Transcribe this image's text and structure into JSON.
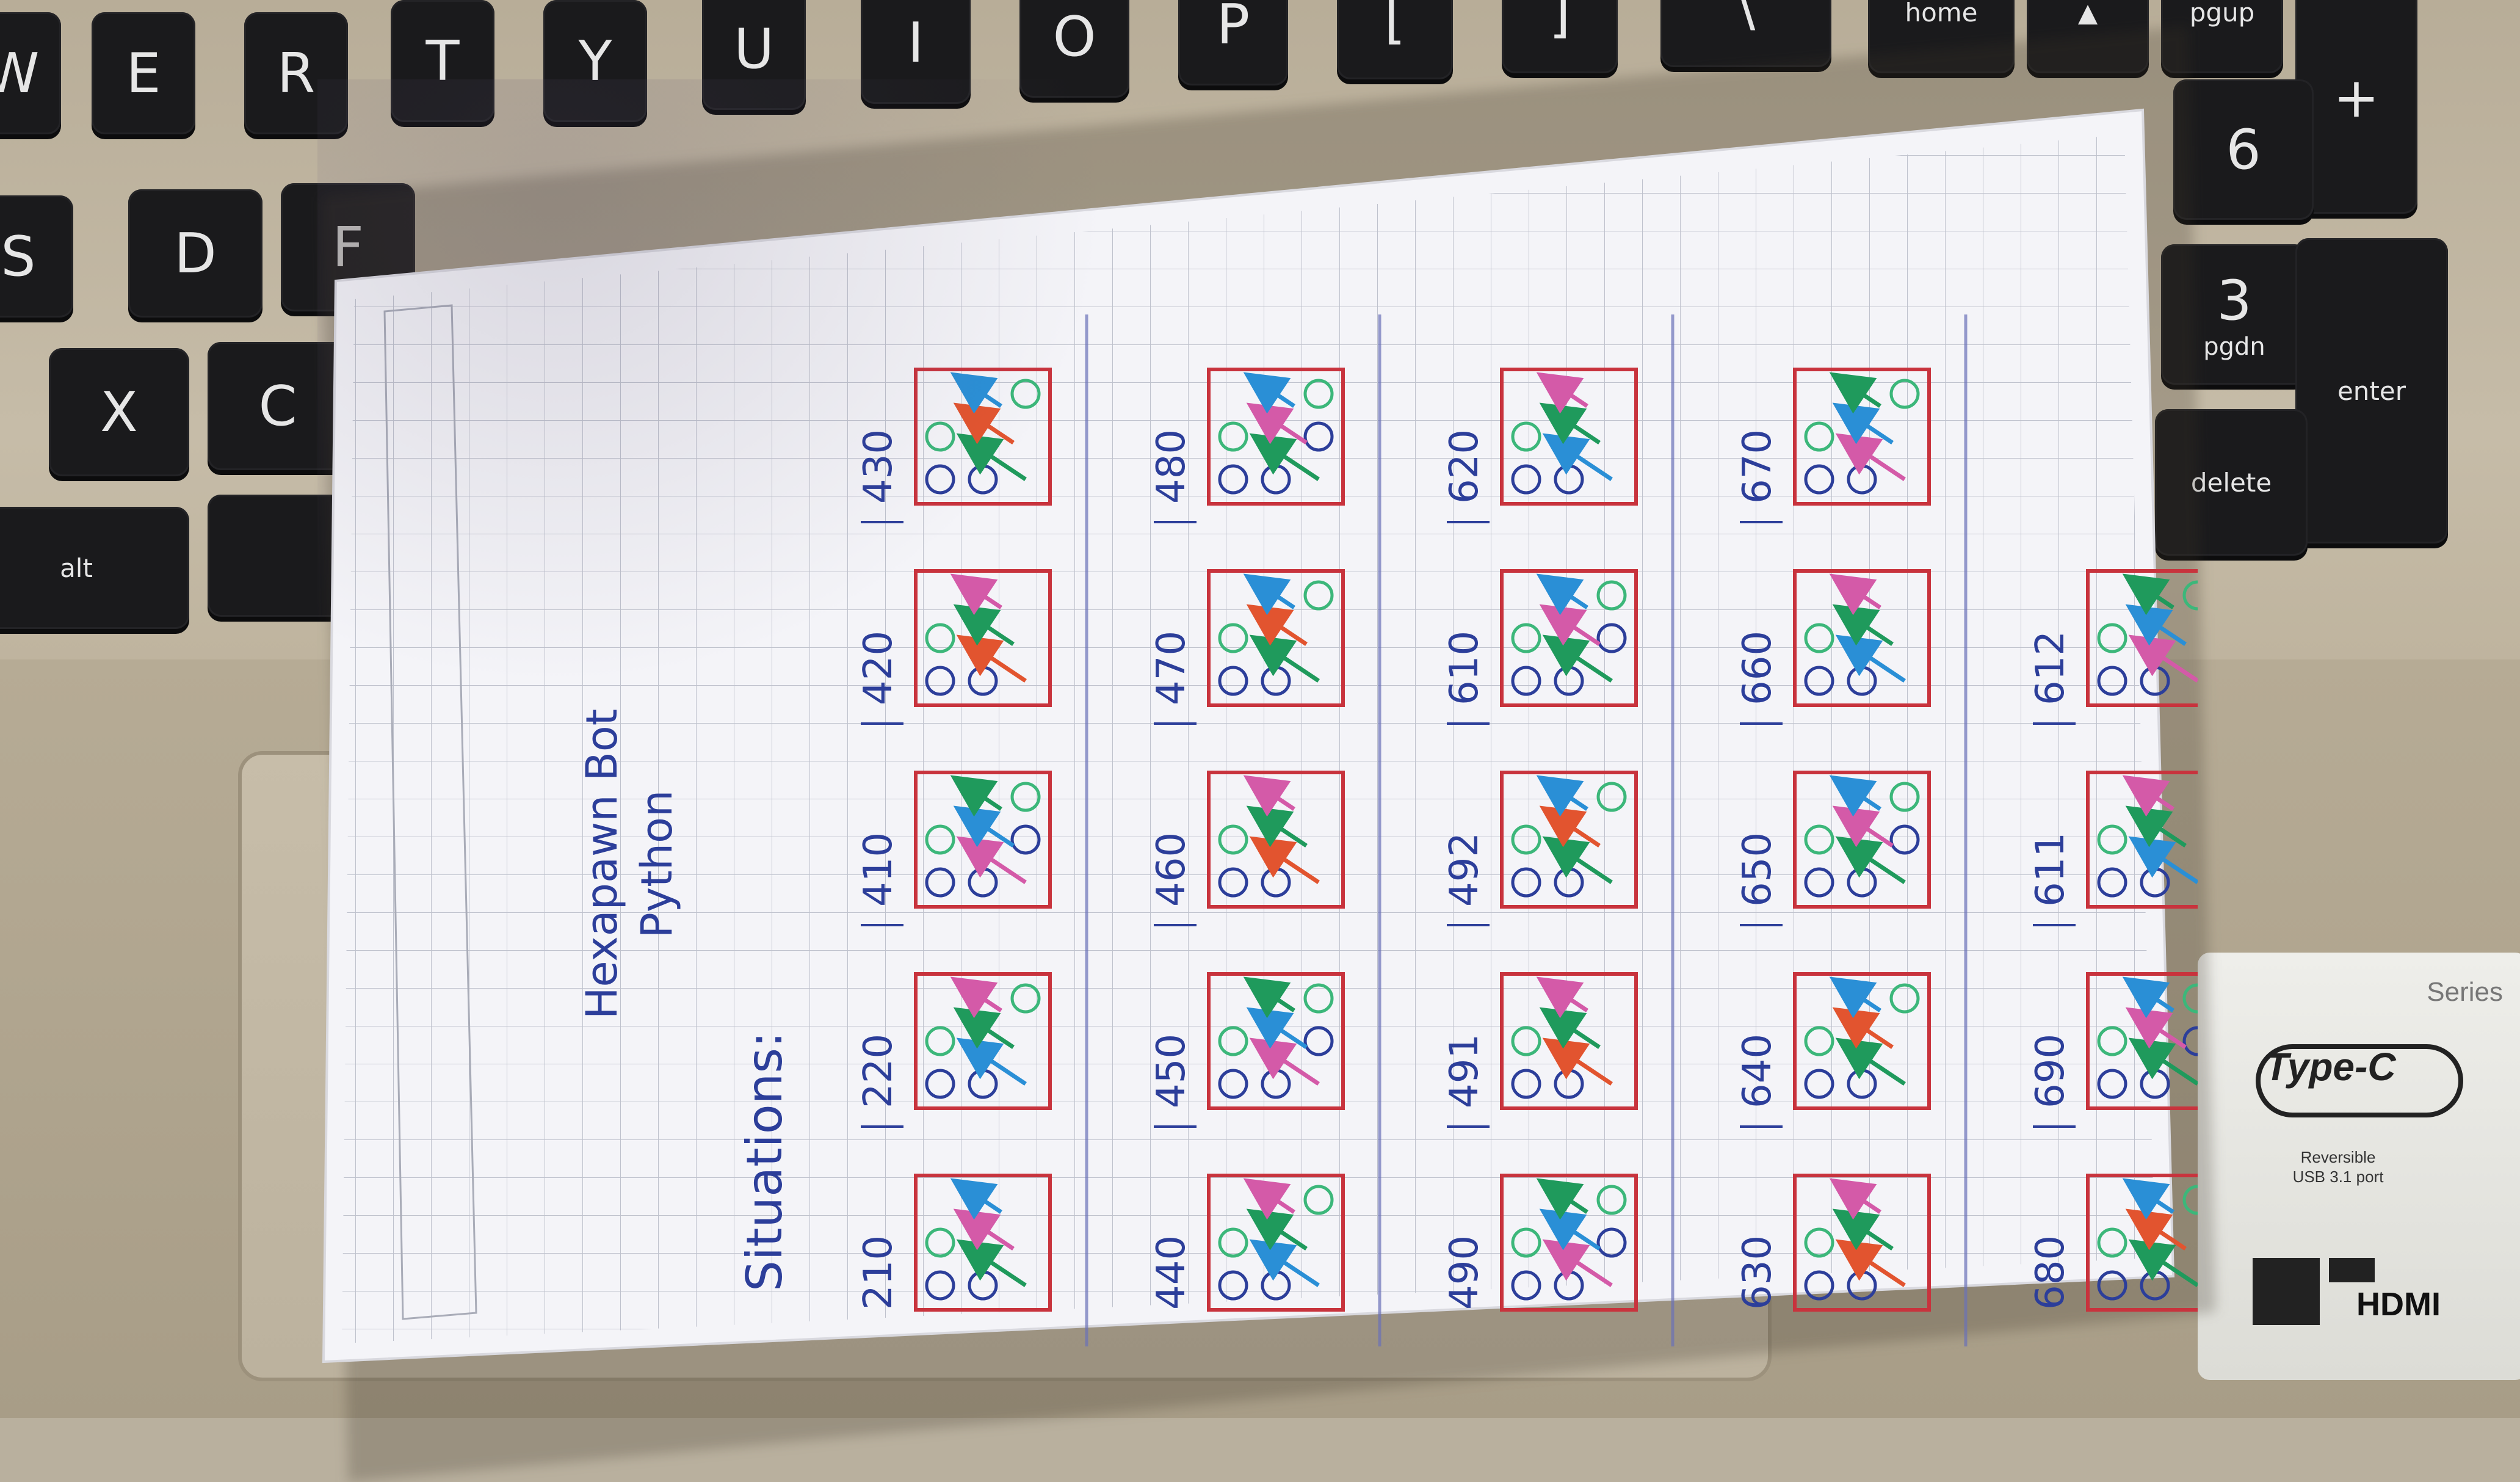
{
  "keyboard": {
    "row_top": [
      "W",
      "E",
      "R",
      "T",
      "Y",
      "U",
      "I",
      "O",
      "P",
      "[",
      "]",
      "\\"
    ],
    "row_top_right": [
      "home",
      "pgup",
      "+"
    ],
    "row_home": [
      "S",
      "D",
      "F"
    ],
    "row_bottom": [
      "X",
      "C"
    ],
    "modifier": "alt",
    "numpad": [
      "6",
      "3",
      "pgdn",
      "enter",
      "delete"
    ]
  },
  "sticker": {
    "series": "Series",
    "type_c": "Type-C",
    "reversible": "Reversible",
    "usb": "USB 3.1 port",
    "hdmi": "HDMI"
  },
  "paper": {
    "title": "Hexapawn Bot",
    "subtitle": "Python",
    "heading": "Situations:",
    "rows": [
      [
        "210",
        "220",
        "410",
        "420",
        "430"
      ],
      [
        "440",
        "450",
        "460",
        "470",
        "480"
      ],
      [
        "490",
        "491",
        "492",
        "610",
        "620"
      ],
      [
        "630",
        "640",
        "650",
        "660",
        "670"
      ],
      [
        "680",
        "690",
        "611",
        "612"
      ]
    ]
  },
  "colors": {
    "box_border": "#c8333d",
    "pen_blue": "#2c3e9a",
    "arrow_green": "#1f9a5c",
    "arrow_pink": "#d45aa8",
    "arrow_cyan": "#2a8fd6",
    "arrow_orange": "#e2542f",
    "paper": "#f4f4f8"
  }
}
